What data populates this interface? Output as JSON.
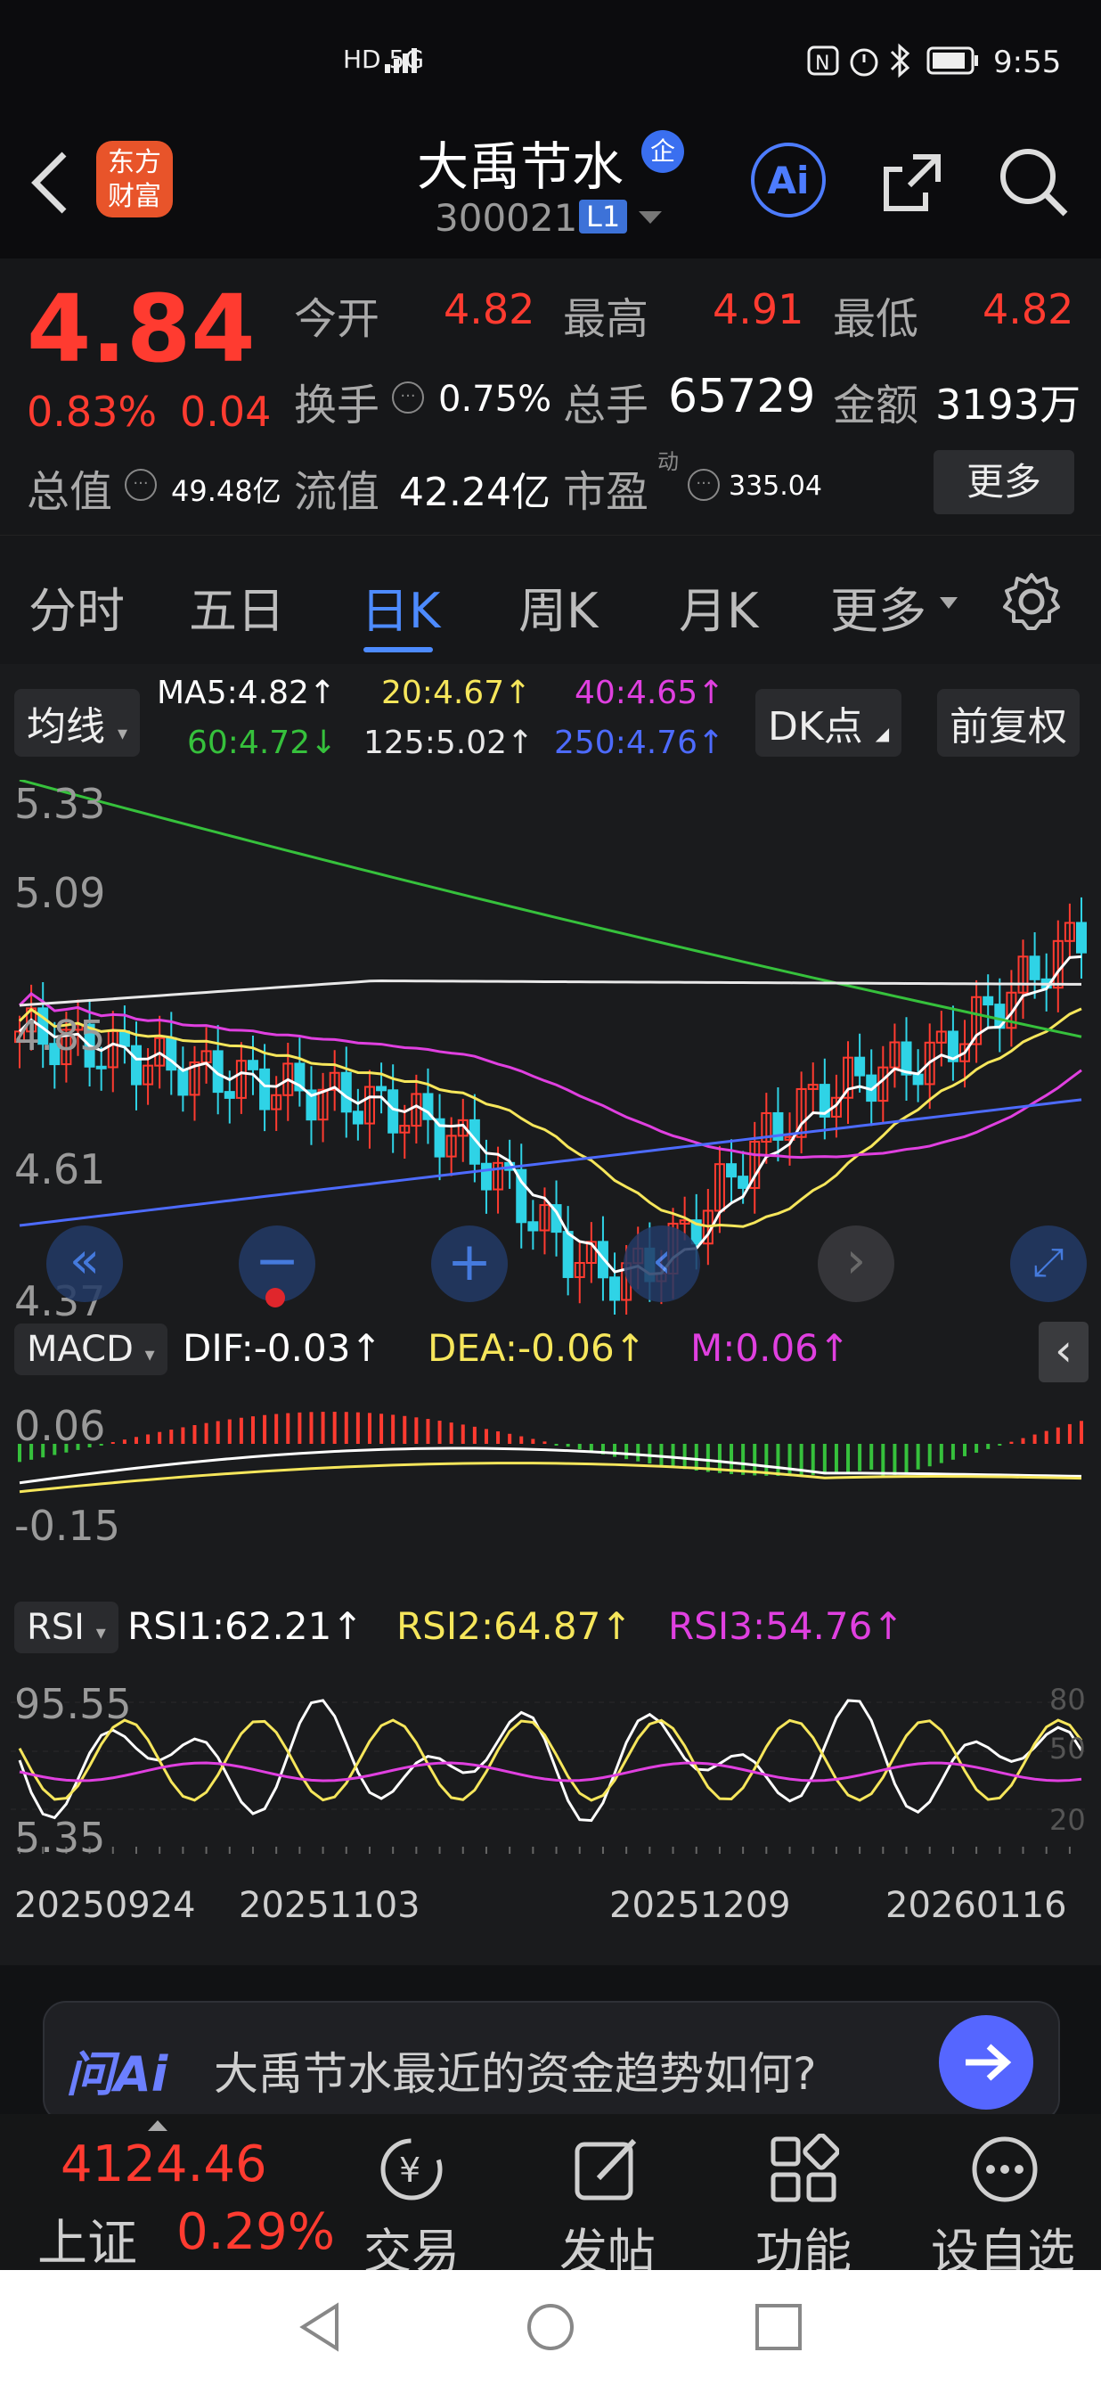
{
  "status_bar": {
    "left": "HD 5G",
    "time": "9:55",
    "icons": [
      "nfc-icon",
      "alarm-icon",
      "bluetooth-icon",
      "battery-icon"
    ]
  },
  "header": {
    "app_badge": "东方财富",
    "title": "大禹节水",
    "title_badge": "企",
    "code": "300021",
    "level": "L1",
    "ai": "Ai"
  },
  "quote": {
    "price": "4.84",
    "change_pct": "0.83%",
    "change_abs": "0.04",
    "open_label": "今开",
    "open": "4.82",
    "high_label": "最高",
    "high": "4.91",
    "low_label": "最低",
    "low": "4.82",
    "turnover_label": "换手",
    "turnover": "0.75%",
    "volume_label": "总手",
    "volume": "65729",
    "amount_label": "金额",
    "amount": "3193万",
    "mktcap_label": "总值",
    "mktcap": "49.48亿",
    "float_label": "流值",
    "float": "42.24亿",
    "pe_label": "市盈",
    "pe_sup": "动",
    "pe": "335.04",
    "more": "更多"
  },
  "tabs": [
    {
      "label": "分时"
    },
    {
      "label": "五日"
    },
    {
      "label": "日K"
    },
    {
      "label": "周K"
    },
    {
      "label": "月K"
    },
    {
      "label": "更多"
    }
  ],
  "ma": {
    "select": "均线",
    "ma5": "MA5:4.82↑",
    "ma20": "20:4.67↑",
    "ma40": "40:4.65↑",
    "ma60": "60:4.72↓",
    "ma125": "125:5.02↑",
    "ma250": "250:4.76↑",
    "dk": "DK点",
    "adjust": "前复权"
  },
  "kline_axis": {
    "p1": "5.33",
    "p2": "5.09",
    "p3": "4.85",
    "p4": "4.61",
    "p5": "4.37"
  },
  "macd": {
    "select": "MACD",
    "dif": "DIF:-0.03↑",
    "dea": "DEA:-0.06↑",
    "m": "M:0.06↑",
    "top": "0.06",
    "bottom": "-0.15"
  },
  "rsi": {
    "select": "RSI",
    "rsi1": "RSI1:62.21↑",
    "rsi2": "RSI2:64.87↑",
    "rsi3": "RSI3:54.76↑",
    "top": "95.55",
    "bottom": "5.35",
    "r80": "80",
    "r50": "50",
    "r20": "20"
  },
  "dates": [
    "20250924",
    "20251103",
    "20251209",
    "20260116"
  ],
  "ai_prompt": {
    "brand": "问Ai",
    "text": "大禹节水最近的资金趋势如何?"
  },
  "bottom_nav": {
    "index_value": "4124.46",
    "index_name": "上证",
    "index_change": "0.29%",
    "trade": "交易",
    "post": "发帖",
    "func": "功能",
    "watch": "设自选"
  },
  "colors": {
    "up": "#ff3b30",
    "down": "#2fd3e6",
    "ma5": "#ffffff",
    "ma20": "#f6e65b",
    "ma40": "#e040e0",
    "ma60": "#36c13c",
    "ma125": "#e8e8e8",
    "ma250": "#4d6bff"
  }
}
